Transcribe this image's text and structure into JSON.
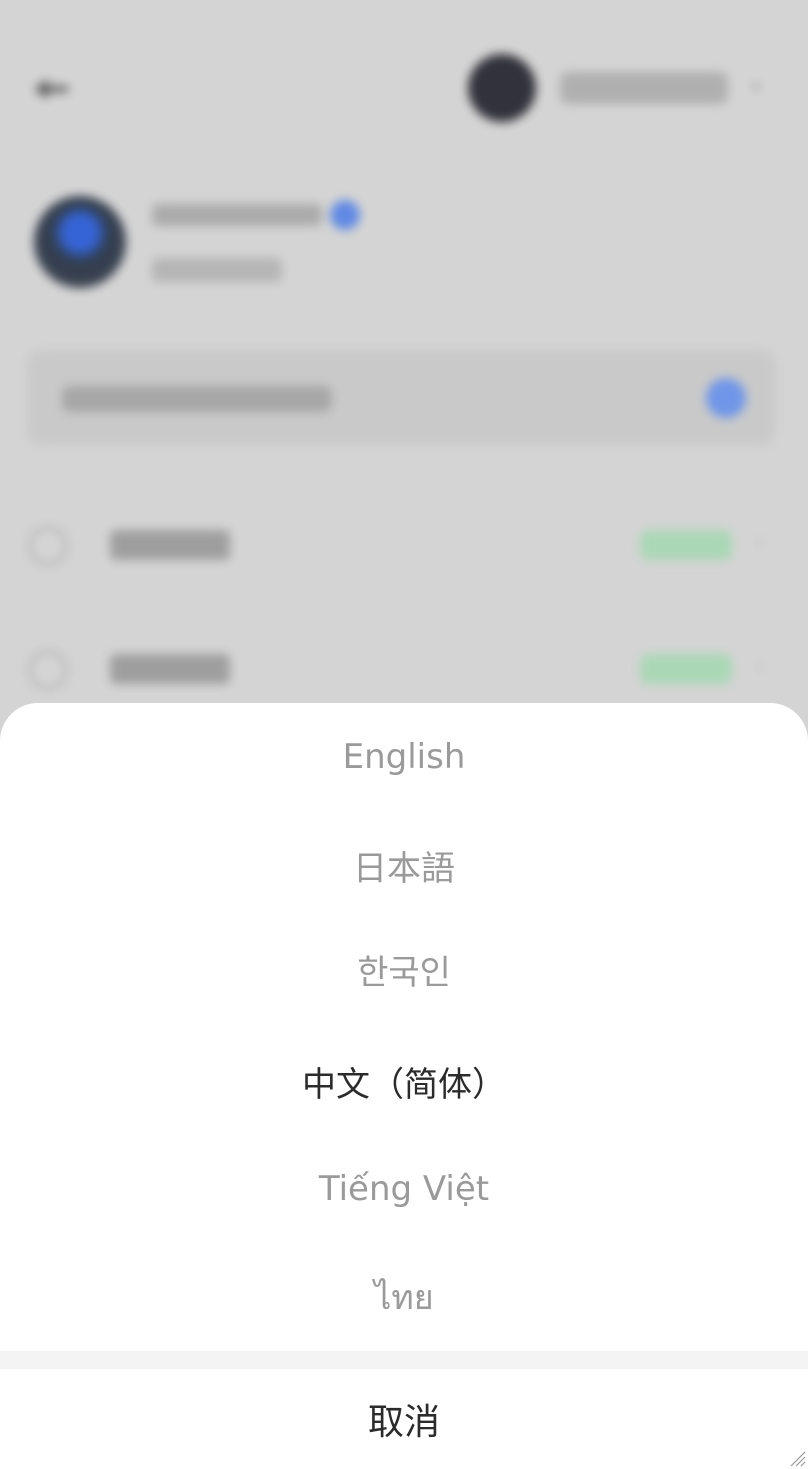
{
  "language_sheet": {
    "options": [
      {
        "label": "English",
        "selected": false
      },
      {
        "label": "日本語",
        "selected": false
      },
      {
        "label": "한국인",
        "selected": false
      },
      {
        "label": "中文（简体）",
        "selected": true
      },
      {
        "label": "Tiếng Việt",
        "selected": false
      },
      {
        "label": "ไทย",
        "selected": false
      }
    ],
    "cancel_label": "取消"
  },
  "colors": {
    "option_text": "#9a9a9a",
    "selected_text": "#2b2b2b",
    "sheet_background": "#ffffff",
    "overlay": "#d4d4d4",
    "divider": "#f4f4f4"
  }
}
